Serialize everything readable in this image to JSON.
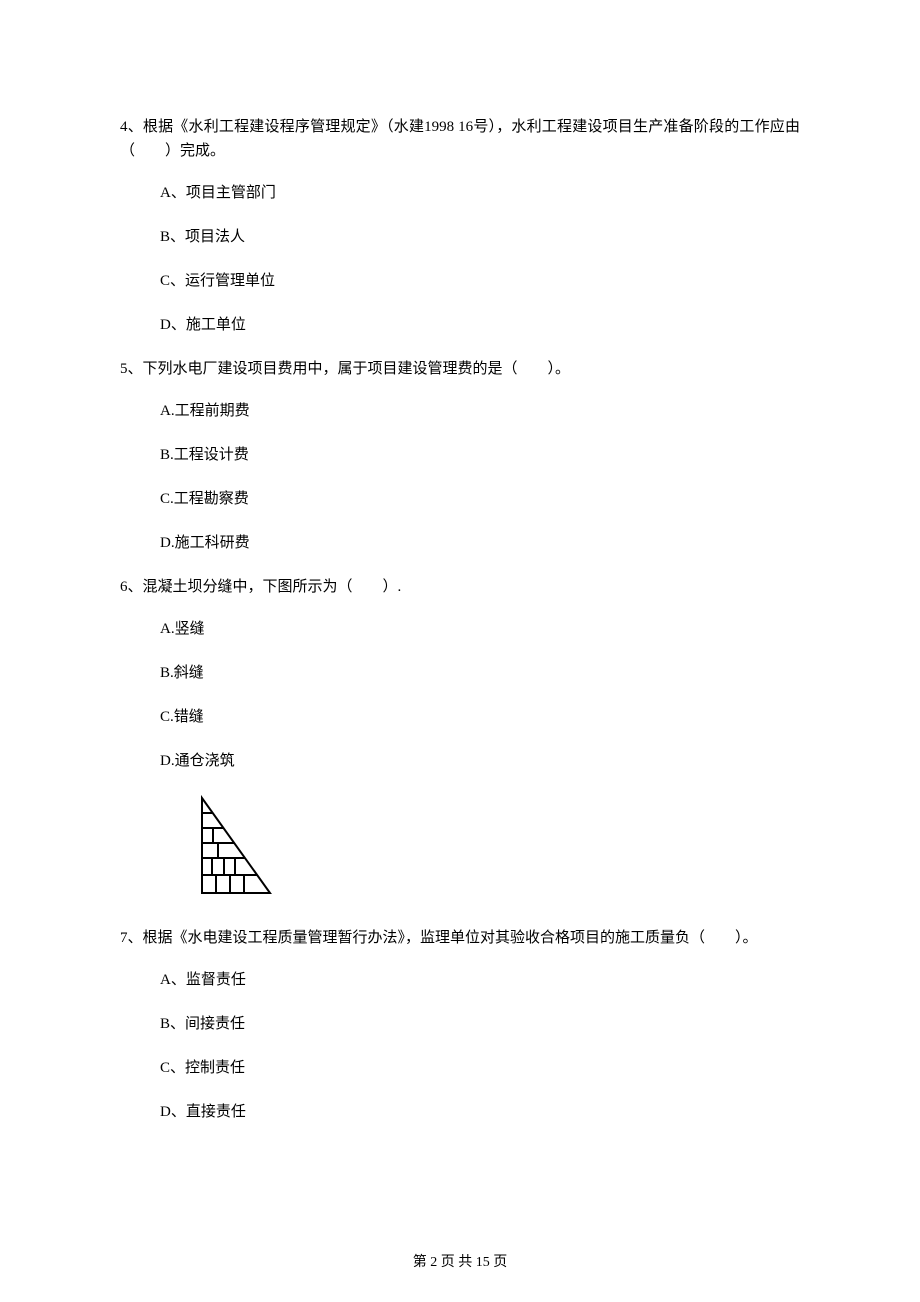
{
  "questions": [
    {
      "text": "4、根据《水利工程建设程序管理规定》（水建1998 16号），水利工程建设项目生产准备阶段的工作应由（　　）完成。",
      "options": {
        "a": "A、项目主管部门",
        "b": "B、项目法人",
        "c": "C、运行管理单位",
        "d": "D、施工单位"
      }
    },
    {
      "text": "5、下列水电厂建设项目费用中，属于项目建设管理费的是（　　）。",
      "options": {
        "a": "A.工程前期费",
        "b": "B.工程设计费",
        "c": "C.工程勘察费",
        "d": "D.施工科研费"
      }
    },
    {
      "text": "6、混凝土坝分缝中，下图所示为（　　）.",
      "options": {
        "a": "A.竖缝",
        "b": "B.斜缝",
        "c": "C.错缝",
        "d": "D.通仓浇筑"
      }
    },
    {
      "text": "7、根据《水电建设工程质量管理暂行办法》，监理单位对其验收合格项目的施工质量负（　　）。",
      "options": {
        "a": "A、监督责任",
        "b": "B、间接责任",
        "c": "C、控制责任",
        "d": "D、直接责任"
      }
    }
  ],
  "footer": "第 2 页 共 15 页"
}
